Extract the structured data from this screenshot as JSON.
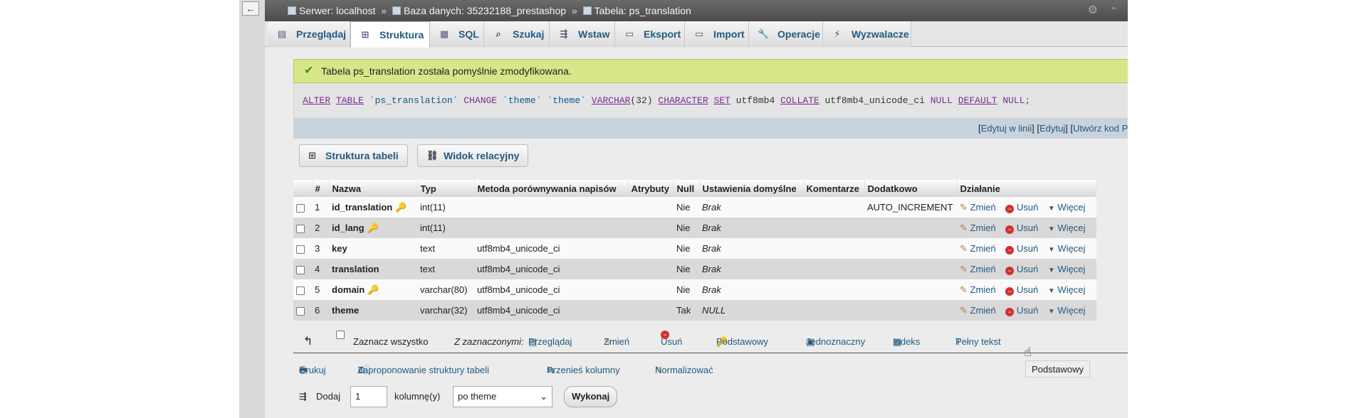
{
  "breadcrumb": {
    "server": "Serwer: localhost",
    "database": "Baza danych: 35232188_prestashop",
    "table": "Tabela: ps_translation",
    "separator": "»"
  },
  "tabs": [
    {
      "label": "Przeglądaj",
      "icon": "browse-icon"
    },
    {
      "label": "Struktura",
      "icon": "structure-icon",
      "active": true
    },
    {
      "label": "SQL",
      "icon": "sql-icon"
    },
    {
      "label": "Szukaj",
      "icon": "search-icon"
    },
    {
      "label": "Wstaw",
      "icon": "insert-icon"
    },
    {
      "label": "Eksport",
      "icon": "export-icon"
    },
    {
      "label": "Import",
      "icon": "import-icon"
    },
    {
      "label": "Operacje",
      "icon": "wrench-icon"
    },
    {
      "label": "Wyzwalacze",
      "icon": "triggers-icon"
    }
  ],
  "message": {
    "success": "Tabela ps_translation została pomyślnie zmodyfikowana."
  },
  "sql": {
    "alter": "ALTER",
    "table_kw": "TABLE",
    "table_name": "`ps_translation`",
    "change": "CHANGE",
    "col1": "`theme`",
    "col2": "`theme`",
    "varchar": "VARCHAR",
    "size": "(32)",
    "character": "CHARACTER",
    "set": "SET",
    "charset": "utf8mb4",
    "collate": "COLLATE",
    "collation": "utf8mb4_unicode_ci",
    "null": "NULL",
    "default": "DEFAULT",
    "null2": "NULL;"
  },
  "sql_links": {
    "open": "[",
    "inline": "Edytuj w linii",
    "mid1": "] [",
    "edit": "Edytuj",
    "mid2": "] [",
    "php": "Utwórz kod PHP",
    "close": "]"
  },
  "view_buttons": {
    "structure": "Struktura tabeli",
    "relation": "Widok relacyjny"
  },
  "table": {
    "headers": [
      "#",
      "Nazwa",
      "Typ",
      "Metoda porównywania napisów",
      "Atrybuty",
      "Null",
      "Ustawienia domyślne",
      "Komentarze",
      "Dodatkowo",
      "Działanie"
    ],
    "rows": [
      {
        "num": "1",
        "name": "id_translation",
        "key": "primary",
        "type": "int(11)",
        "collation": "",
        "null": "Nie",
        "default": "Brak",
        "extra": "AUTO_INCREMENT"
      },
      {
        "num": "2",
        "name": "id_lang",
        "key": "index",
        "type": "int(11)",
        "collation": "",
        "null": "Nie",
        "default": "Brak",
        "extra": ""
      },
      {
        "num": "3",
        "name": "key",
        "key": "",
        "type": "text",
        "collation": "utf8mb4_unicode_ci",
        "null": "Nie",
        "default": "Brak",
        "extra": ""
      },
      {
        "num": "4",
        "name": "translation",
        "key": "",
        "type": "text",
        "collation": "utf8mb4_unicode_ci",
        "null": "Nie",
        "default": "Brak",
        "extra": ""
      },
      {
        "num": "5",
        "name": "domain",
        "key": "index",
        "type": "varchar(80)",
        "collation": "utf8mb4_unicode_ci",
        "null": "Nie",
        "default": "Brak",
        "extra": ""
      },
      {
        "num": "6",
        "name": "theme",
        "key": "",
        "type": "varchar(32)",
        "collation": "utf8mb4_unicode_ci",
        "null": "Tak",
        "default": "NULL",
        "extra": ""
      }
    ],
    "actions": {
      "change": "Zmień",
      "delete": "Usuń",
      "more": "Więcej"
    }
  },
  "bulk": {
    "select_all": "Zaznacz wszystko",
    "with_selected": "Z zaznaczonymi:",
    "browse": "Przeglądaj",
    "change": "Zmień",
    "delete": "Usuń",
    "primary": "Podstawowy",
    "unique": "Jednoznaczny",
    "index": "Indeks",
    "fulltext": "Pełny tekst"
  },
  "tooltip": "Podstawowy",
  "tools": {
    "print": "Drukuj",
    "propose": "Zaproponowanie struktury tabeli",
    "move": "Przenieś kolumny",
    "normalize": "Normalizować"
  },
  "add": {
    "label": "Dodaj",
    "count": "1",
    "unit": "kolumnę(y)",
    "position": "po theme",
    "go": "Wykonaj"
  }
}
